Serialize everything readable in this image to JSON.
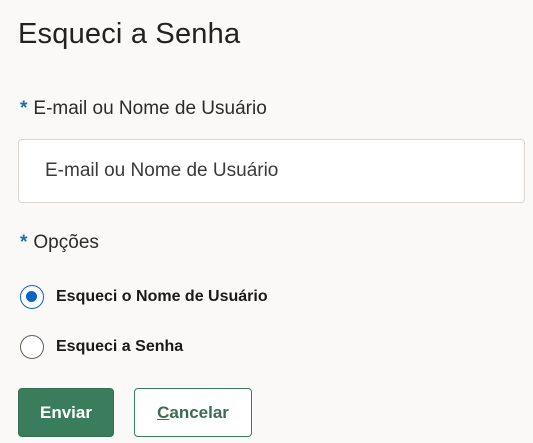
{
  "page": {
    "title": "Esqueci a Senha"
  },
  "form": {
    "required_marker": "*",
    "identifier_label": "E-mail ou Nome de Usuário",
    "identifier_placeholder": "E-mail ou Nome de Usuário",
    "identifier_value": "",
    "options_label": "Opções",
    "options": [
      {
        "label": "Esqueci o Nome de Usuário",
        "selected": true
      },
      {
        "label": "Esqueci a Senha",
        "selected": false
      }
    ]
  },
  "actions": {
    "send_label": "Enviar",
    "cancel_mnemonic": "C",
    "cancel_rest": "ancelar"
  },
  "colors": {
    "primary_button": "#3a7d5c",
    "required_marker": "#1a6fb0",
    "radio_selected": "#0a64c8"
  }
}
